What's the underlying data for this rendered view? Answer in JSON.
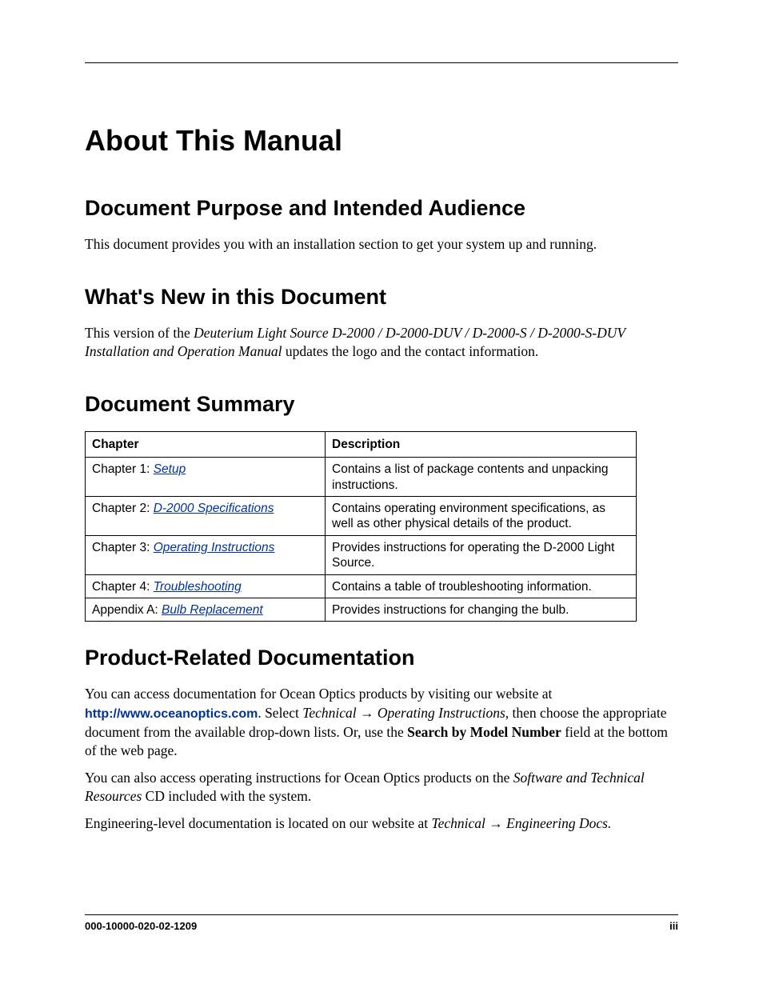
{
  "title": "About This Manual",
  "sections": {
    "purpose": {
      "heading": "Document Purpose and Intended Audience",
      "body": "This document provides you with an installation section to get your system up and running."
    },
    "whatsnew": {
      "heading": "What's New in this Document",
      "prefix": "This version of the ",
      "manual_title": "Deuterium Light Source D-2000 / D-2000-DUV / D-2000-S / D-2000-S-DUV Installation and Operation Manual",
      "suffix": " updates the logo and the contact information."
    },
    "summary": {
      "heading": "Document Summary",
      "headers": {
        "chapter": "Chapter",
        "description": "Description"
      },
      "rows": [
        {
          "label": "Chapter 1: ",
          "link": "Setup",
          "desc": "Contains a list of package contents and unpacking instructions."
        },
        {
          "label": "Chapter 2: ",
          "link": "D-2000 Specifications",
          "desc": "Contains operating environment specifications, as well as other physical details of the product."
        },
        {
          "label": "Chapter 3: ",
          "link": "Operating Instructions",
          "desc": "Provides instructions for operating the D-2000 Light Source."
        },
        {
          "label": "Chapter 4: ",
          "link": "Troubleshooting",
          "desc": "Contains a table of troubleshooting information."
        },
        {
          "label": "Appendix A: ",
          "link": "Bulb Replacement",
          "desc": "Provides instructions for changing the bulb."
        }
      ]
    },
    "related": {
      "heading": "Product-Related Documentation",
      "p1_prefix": "You can access documentation for Ocean Optics products by visiting our website at ",
      "url": "http://www.oceanoptics.com",
      "p1_after_url": ". Select ",
      "nav1": "Technical → Operating Instructions",
      "p1_mid": ", then choose the appropriate document from the available drop-down lists. Or, use the ",
      "search_field": "Search by Model Number",
      "p1_end": " field at the bottom of the web page.",
      "p2_prefix": "You can also access operating instructions for Ocean Optics products on the ",
      "cd_name": "Software and Technical Resources",
      "p2_suffix": " CD included with the system.",
      "p3_prefix": "Engineering-level documentation is located on our website at ",
      "nav2": "Technical → Engineering Docs."
    }
  },
  "footer": {
    "docnum": "000-10000-020-02-1209",
    "pagenum": "iii"
  }
}
